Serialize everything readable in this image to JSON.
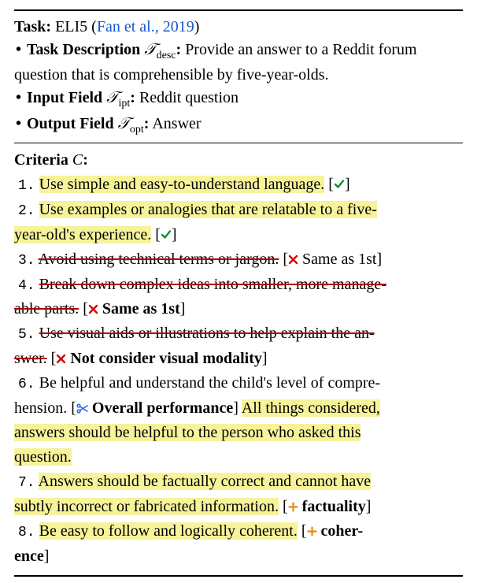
{
  "header": {
    "task_label": "Task:",
    "task_name": "ELI5",
    "task_cite": "Fan et al., 2019",
    "desc_label": "Task Description",
    "desc_sym": "𝒯",
    "desc_sub": "desc",
    "desc_text": " Provide an answer to a Reddit forum question that is comprehensible by five-year-olds.",
    "ipt_label": "Input Field",
    "ipt_sym": "𝒯",
    "ipt_sub": "ipt",
    "ipt_text": " Reddit question",
    "opt_label": "Output Field",
    "opt_sym": "𝒯",
    "opt_sub": "opt",
    "opt_text": " Answer"
  },
  "criteria": {
    "label": "Criteria",
    "sym": "C",
    "items": [
      {
        "n": "1.",
        "body": "Use simple and easy-to-understand language.",
        "status": "accept"
      },
      {
        "n": "2.",
        "body_a": "Use examples or analogies that are relatable to a five-",
        "body_b": "year-old's experience.",
        "status": "accept"
      },
      {
        "n": "3.",
        "body": "Avoid using technical terms or jargon.",
        "status": "reject",
        "tag": "Same as 1st"
      },
      {
        "n": "4.",
        "body_a": "Break down complex ideas into smaller, more manage-",
        "body_b": "able parts.",
        "status": "reject",
        "tag": "Same as 1st"
      },
      {
        "n": "5.",
        "body_a": "Use visual aids or illustrations to help explain the an-",
        "body_b": "swer.",
        "status": "reject",
        "tag": "Not consider visual modality"
      },
      {
        "n": "6.",
        "body": "Be helpful and understand the child's level of compre-",
        "body_wrap": "hension.",
        "status": "edit",
        "tag": "Overall performance",
        "extra_a": "All things considered,",
        "extra_b": "answers should be helpful to the person who asked this",
        "extra_c": "question."
      },
      {
        "n": "7.",
        "body_a": "Answers should be factually correct and cannot have",
        "body_b": "subtly incorrect or fabricated information.",
        "status": "add",
        "tag": "factuality"
      },
      {
        "n": "8.",
        "body": "Be easy to follow and logically coherent.",
        "status": "add",
        "tag": "coher-",
        "tag2": "ence"
      }
    ]
  },
  "chart_data": {
    "type": "table",
    "title": "Criteria derivation example (ELI5)",
    "rows": [
      {
        "n": 1,
        "criterion": "Use simple and easy-to-understand language.",
        "decision": "accept",
        "reason": ""
      },
      {
        "n": 2,
        "criterion": "Use examples or analogies that are relatable to a five-year-old's experience.",
        "decision": "accept",
        "reason": ""
      },
      {
        "n": 3,
        "criterion": "Avoid using technical terms or jargon.",
        "decision": "reject",
        "reason": "Same as 1st"
      },
      {
        "n": 4,
        "criterion": "Break down complex ideas into smaller, more manageable parts.",
        "decision": "reject",
        "reason": "Same as 1st"
      },
      {
        "n": 5,
        "criterion": "Use visual aids or illustrations to help explain the answer.",
        "decision": "reject",
        "reason": "Not consider visual modality"
      },
      {
        "n": 6,
        "criterion": "Be helpful and understand the child's level of comprehension. All things considered, answers should be helpful to the person who asked this question.",
        "decision": "edit",
        "reason": "Overall performance"
      },
      {
        "n": 7,
        "criterion": "Answers should be factually correct and cannot have subtly incorrect or fabricated information.",
        "decision": "add",
        "reason": "factuality"
      },
      {
        "n": 8,
        "criterion": "Be easy to follow and logically coherent.",
        "decision": "add",
        "reason": "coherence"
      }
    ]
  }
}
